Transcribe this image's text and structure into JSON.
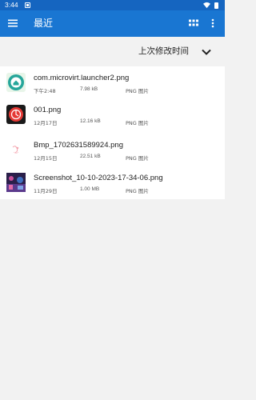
{
  "status_bar": {
    "time": "3:44"
  },
  "app_bar": {
    "title": "最近"
  },
  "sort": {
    "label": "上次修改时间"
  },
  "files": [
    {
      "name": "com.microvirt.launcher2.png",
      "date": "下午2:48",
      "size": "7.98 kB",
      "type": "PNG 图片",
      "thumb": "launcher-app-icon"
    },
    {
      "name": "001.png",
      "date": "12月17日",
      "size": "12.16 kB",
      "type": "PNG 图片",
      "thumb": "red-circle-logo"
    },
    {
      "name": "Bmp_1702631589924.png",
      "date": "12月15日",
      "size": "22.51 kB",
      "type": "PNG 图片",
      "thumb": "pink-sketch-image"
    },
    {
      "name": "Screenshot_10-10-2023-17-34-06.png",
      "date": "11月29日",
      "size": "1.00 MB",
      "type": "PNG 图片",
      "thumb": "screenshot-photo"
    }
  ],
  "colors": {
    "status_bar": "#1565c0",
    "app_bar": "#1976d2",
    "background": "#f2f2f2",
    "list_bg": "#ffffff"
  }
}
